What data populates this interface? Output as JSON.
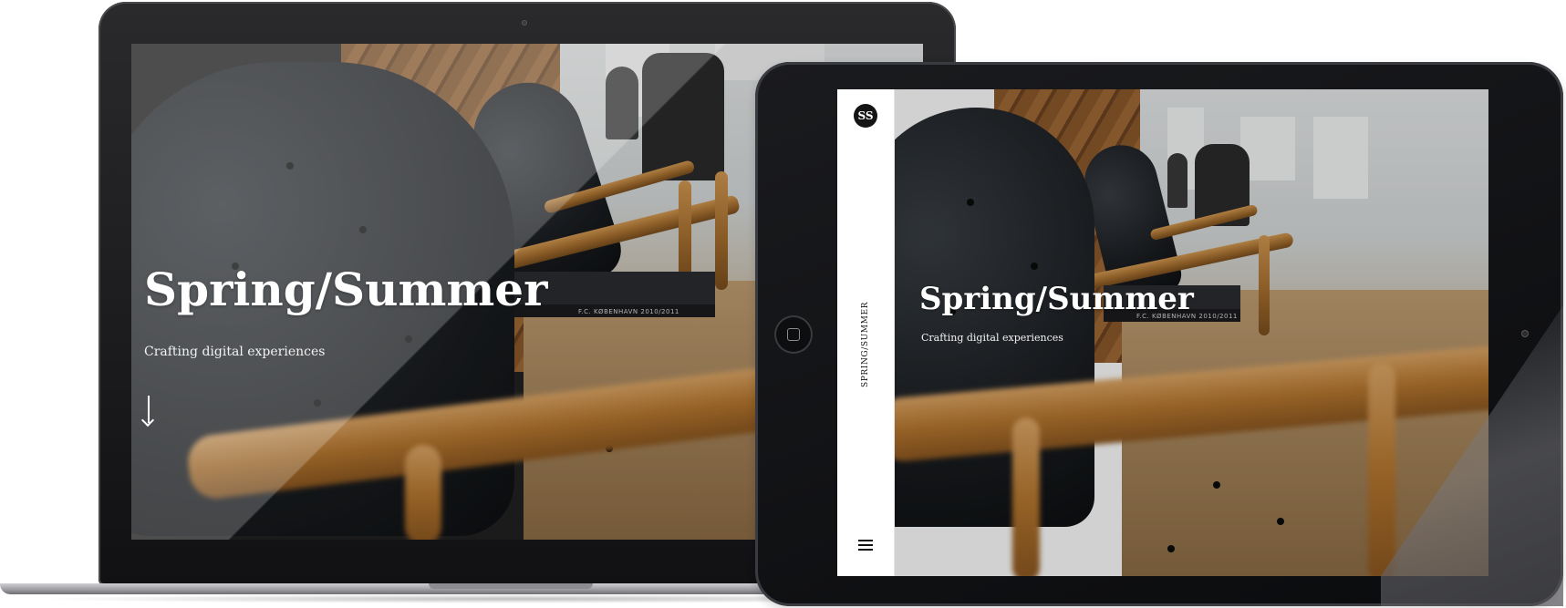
{
  "laptop": {
    "hero": {
      "title": "Spring/Summer",
      "subtitle": "Crafting digital experiences"
    },
    "book_spine": "F.C. KØBENHAVN 2010/2011"
  },
  "tablet": {
    "logo_text": "SS",
    "vertical_label": "SPRING/SUMMER",
    "hero": {
      "title": "Spring/Summer",
      "subtitle": "Crafting digital experiences"
    },
    "book_spine": "F.C. KØBENHAVN 2010/2011"
  },
  "icons": {
    "scroll_down": "down-arrow-icon",
    "menu": "hamburger-menu-icon",
    "home_button": "home-button-icon"
  },
  "colors": {
    "hero_text": "#ffffff",
    "sidebar_bg": "#ffffff",
    "device_frame": "#111113"
  }
}
